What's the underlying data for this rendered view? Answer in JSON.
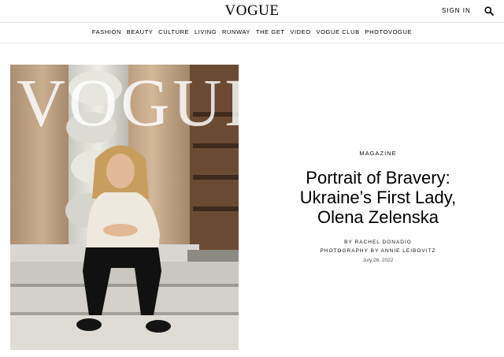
{
  "header": {
    "logo": "VOGUE",
    "sign_in": "SIGN IN",
    "search_icon": "search-icon"
  },
  "nav": {
    "items": [
      "FASHION",
      "BEAUTY",
      "CULTURE",
      "LIVING",
      "RUNWAY",
      "THE GET",
      "VIDEO",
      "VOGUE CLUB",
      "PHOTOVOGUE"
    ]
  },
  "cover": {
    "masthead": "VOGUE"
  },
  "article": {
    "kicker": "MAGAZINE",
    "headline_lines": [
      "Portrait of Bravery:",
      "Ukraine’s First Lady,",
      "Olena Zelenska"
    ],
    "byline": "BY RACHEL DONADIO",
    "photography": "PHOTOGRAPHY BY ANNIE LEIBOVITZ",
    "date": "July 26, 2022"
  }
}
